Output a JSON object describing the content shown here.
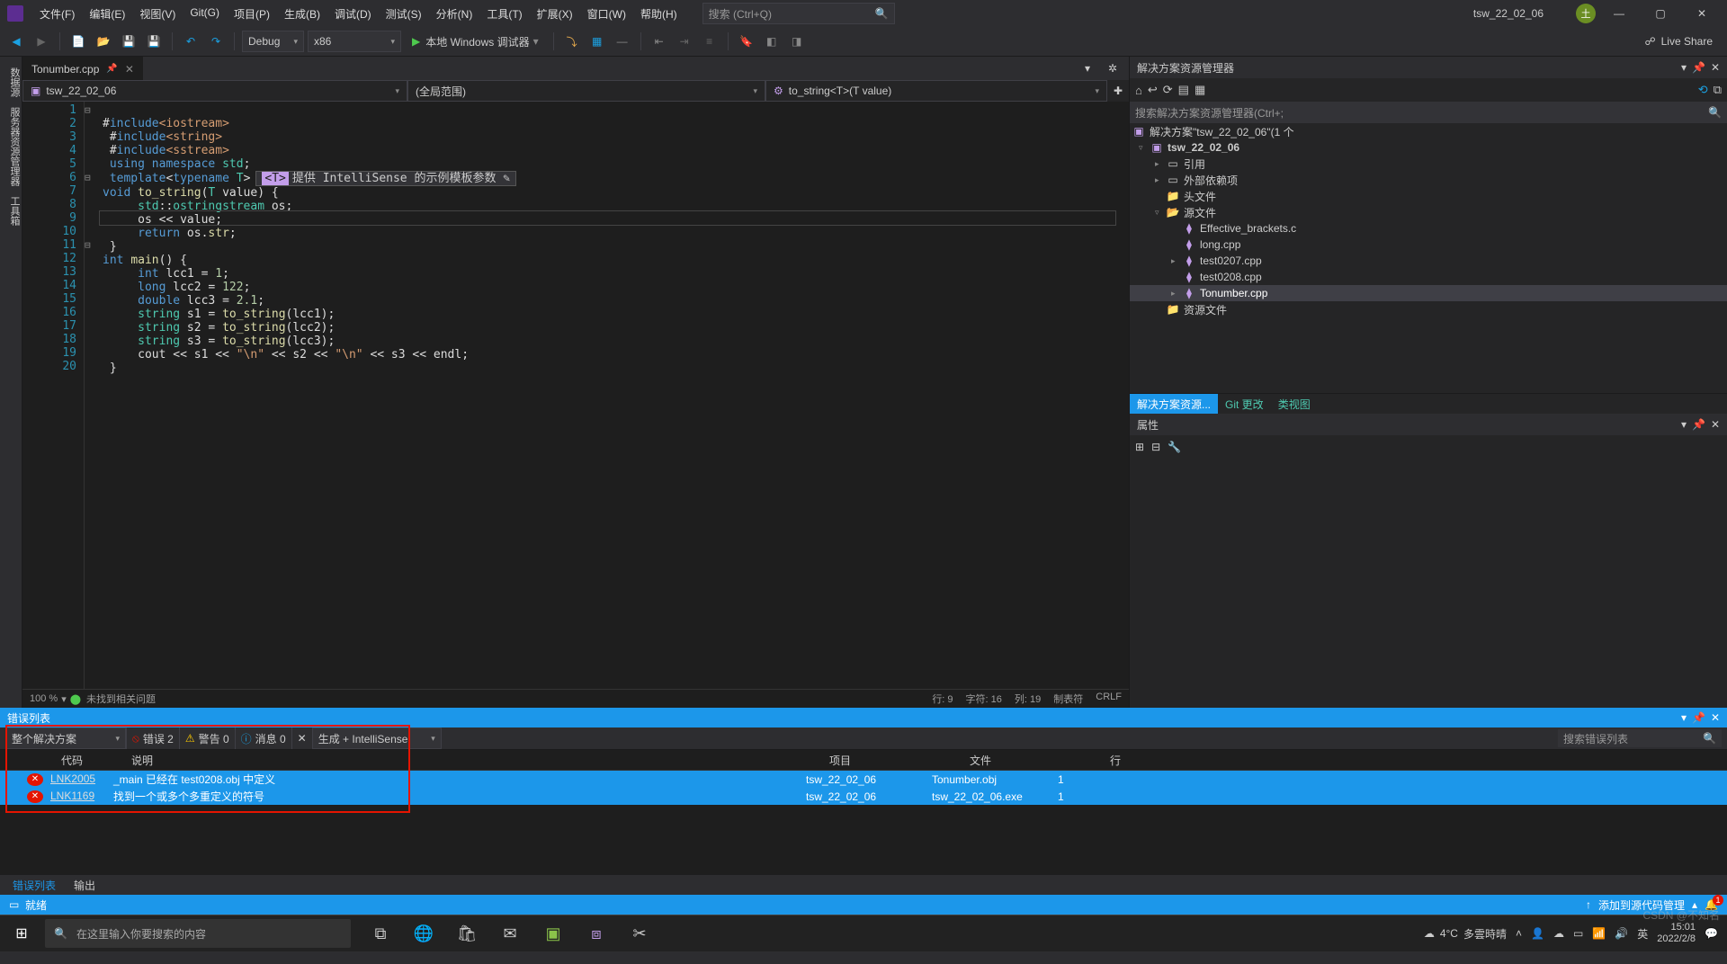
{
  "title": {
    "project": "tsw_22_02_06"
  },
  "menu": [
    "文件(F)",
    "编辑(E)",
    "视图(V)",
    "Git(G)",
    "项目(P)",
    "生成(B)",
    "调试(D)",
    "测试(S)",
    "分析(N)",
    "工具(T)",
    "扩展(X)",
    "窗口(W)",
    "帮助(H)"
  ],
  "search_placeholder": "搜索 (Ctrl+Q)",
  "user_initial": "土",
  "toolbar": {
    "config": "Debug",
    "platform": "x86",
    "debugger": "本地 Windows 调试器",
    "liveshare": "Live Share"
  },
  "left_tabs": [
    "数据源",
    "服务器资源管理器",
    "工具箱"
  ],
  "editor": {
    "tab": "Tonumber.cpp",
    "nav_file": "tsw_22_02_06",
    "nav_scope": "(全局范围)",
    "nav_func": "to_string<T>(T value)",
    "lines": [
      "1",
      "2",
      "3",
      "4",
      "5",
      "6",
      "7",
      "8",
      "9",
      "10",
      "11",
      "12",
      "13",
      "14",
      "15",
      "16",
      "17",
      "18",
      "19",
      "20"
    ],
    "hint": "提供 IntelliSense 的示例模板参数",
    "hint_tag": "<T>",
    "zoom": "100 %",
    "issues": "未找到相关问题",
    "pos": {
      "line": "行: 9",
      "char": "字符: 16",
      "col": "列: 19",
      "tab": "制表符",
      "crlf": "CRLF"
    }
  },
  "solution": {
    "panel": "解决方案资源管理器",
    "search": "搜索解决方案资源管理器(Ctrl+;",
    "root": "解决方案\"tsw_22_02_06\"(1 个",
    "proj": "tsw_22_02_06",
    "refs": "引用",
    "ext": "外部依赖项",
    "headers": "头文件",
    "src": "源文件",
    "files": [
      "Effective_brackets.c",
      "long.cpp",
      "test0207.cpp",
      "test0208.cpp",
      "Tonumber.cpp"
    ],
    "res": "资源文件",
    "btabs": [
      "解决方案资源...",
      "Git 更改",
      "类视图"
    ],
    "props": "属性"
  },
  "errors": {
    "panel": "错误列表",
    "scope": "整个解决方案",
    "err": "错误 2",
    "warn": "警告 0",
    "msg": "消息 0",
    "src": "生成 + IntelliSense",
    "search": "搜索错误列表",
    "cols": {
      "code": "代码",
      "desc": "说明",
      "proj": "项目",
      "file": "文件",
      "line": "行"
    },
    "rows": [
      {
        "code": "LNK2005",
        "desc": "_main 已经在 test0208.obj 中定义",
        "proj": "tsw_22_02_06",
        "file": "Tonumber.obj",
        "line": "1"
      },
      {
        "code": "LNK1169",
        "desc": "找到一个或多个多重定义的符号",
        "proj": "tsw_22_02_06",
        "file": "tsw_22_02_06.exe",
        "line": "1"
      }
    ],
    "btabs": [
      "错误列表",
      "输出"
    ]
  },
  "statusbar": {
    "ready": "就绪",
    "src": "添加到源代码管理",
    "bell": "1"
  },
  "taskbar": {
    "search": "在这里输入你要搜索的内容",
    "temp": "4°C",
    "weather": "多雲時晴",
    "time": "15:01",
    "date": "2022/2/8"
  },
  "watermark": "CSDN @不知名"
}
